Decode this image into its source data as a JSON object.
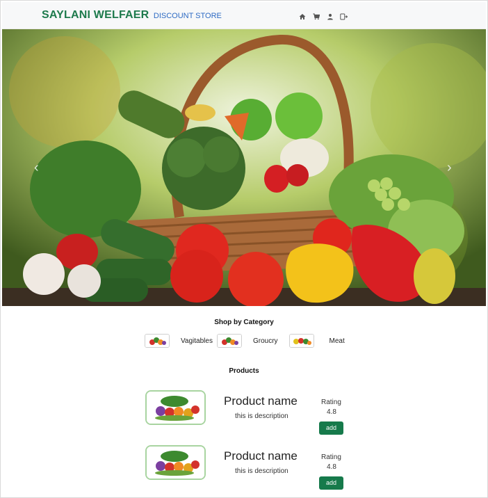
{
  "brand": {
    "name": "SAYLANI WELFAER",
    "tagline": "DISCOUNT STORE"
  },
  "nav": {
    "icons": [
      "home-icon",
      "cart-icon",
      "user-icon",
      "logout-icon"
    ]
  },
  "hero": {
    "image": "vegetable-basket-photo"
  },
  "categories": {
    "title": "Shop by Category",
    "items": [
      {
        "label": "Vagitables"
      },
      {
        "label": "Groucry"
      },
      {
        "label": "Meat"
      }
    ]
  },
  "products": {
    "title": "Products",
    "items": [
      {
        "name": "Product name",
        "description": "this is description",
        "rating_label": "Rating",
        "rating": "4.8",
        "button": "add"
      },
      {
        "name": "Product name",
        "description": "this is description",
        "rating_label": "Rating",
        "rating": "4.8",
        "button": "add"
      }
    ]
  },
  "colors": {
    "brand_green": "#1d7a4c",
    "tagline_blue": "#2d6ac3",
    "button_green": "#167a4b"
  }
}
